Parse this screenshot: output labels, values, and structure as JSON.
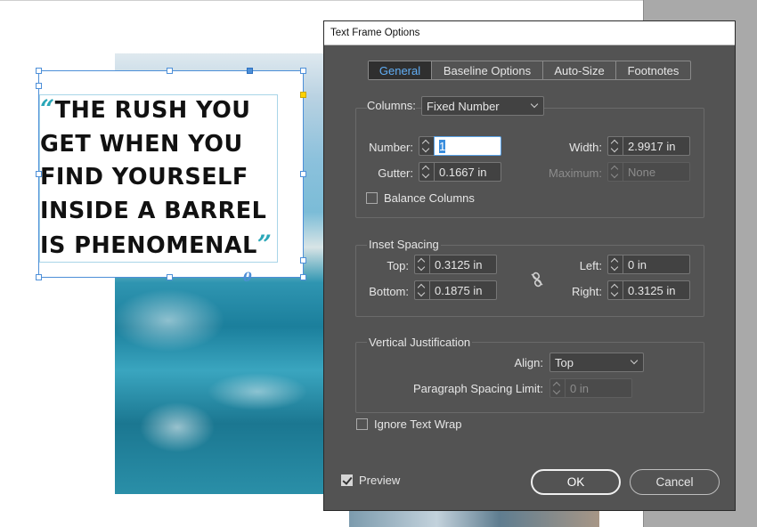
{
  "canvas": {
    "quote_open": "“",
    "quote_close": "”",
    "quote_lines": [
      "THE RUSH YOU",
      "GET WHEN YOU",
      "FIND YOURSELF",
      "INSIDE A BARREL",
      "IS PHENOMENAL"
    ],
    "overset_port": "0",
    "accent_color": "#2aa7b8"
  },
  "dialog": {
    "title": "Text Frame Options",
    "tabs": [
      {
        "label": "General",
        "active": true
      },
      {
        "label": "Baseline Options",
        "active": false
      },
      {
        "label": "Auto-Size",
        "active": false
      },
      {
        "label": "Footnotes",
        "active": false
      }
    ],
    "columns": {
      "label": "Columns:",
      "type_value": "Fixed Number",
      "number_label": "Number:",
      "number_value": "1",
      "gutter_label": "Gutter:",
      "gutter_value": "0.1667 in",
      "width_label": "Width:",
      "width_value": "2.9917 in",
      "maximum_label": "Maximum:",
      "maximum_value": "None",
      "balance_label": "Balance Columns",
      "balance_checked": false
    },
    "inset": {
      "title": "Inset Spacing",
      "top_label": "Top:",
      "top_value": "0.3125 in",
      "bottom_label": "Bottom:",
      "bottom_value": "0.1875 in",
      "left_label": "Left:",
      "left_value": "0 in",
      "right_label": "Right:",
      "right_value": "0.3125 in",
      "link_icon": "broken-chain-link-icon"
    },
    "vertical": {
      "title": "Vertical Justification",
      "align_label": "Align:",
      "align_value": "Top",
      "spacing_label": "Paragraph Spacing Limit:",
      "spacing_value": "0 in"
    },
    "ignore_wrap_label": "Ignore Text Wrap",
    "ignore_wrap_checked": false,
    "preview_label": "Preview",
    "preview_checked": true,
    "ok_label": "OK",
    "cancel_label": "Cancel",
    "colors": {
      "dialog_bg": "#535353",
      "active_tab_text": "#61aef5"
    }
  }
}
